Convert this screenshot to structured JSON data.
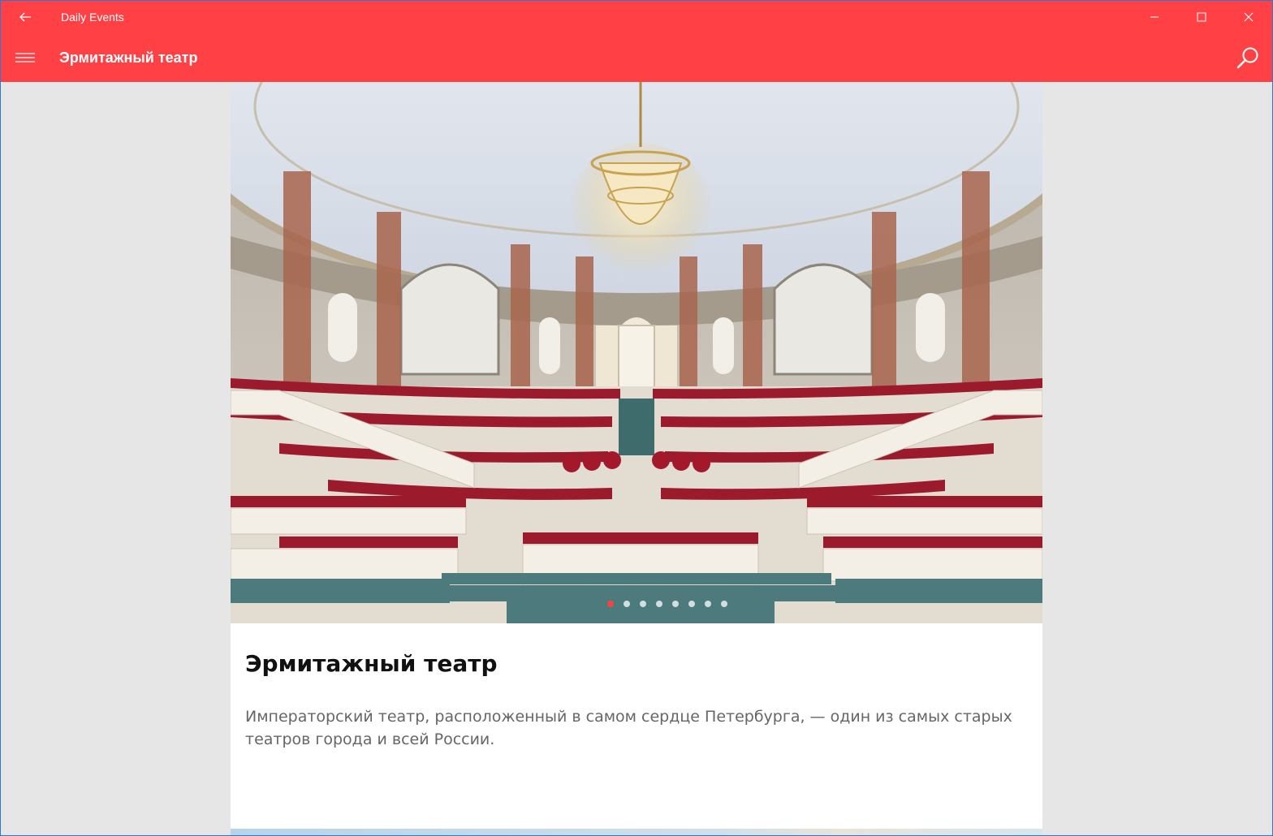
{
  "window": {
    "app_title": "Daily Events"
  },
  "appbar": {
    "page_title": "Эрмитажный театр"
  },
  "event": {
    "title": "Эрмитажный театр",
    "description": "Императорский театр, расположенный в самом сердце Петербурга, — один из самых старых театров города и всей России."
  },
  "gallery": {
    "total_images": 8,
    "active_index": 0
  },
  "colors": {
    "accent": "#ff4045",
    "background": "#e6e6e6",
    "card": "#ffffff"
  },
  "icons": [
    "back-arrow-icon",
    "minimize-icon",
    "maximize-icon",
    "close-icon",
    "hamburger-menu-icon",
    "search-icon"
  ]
}
